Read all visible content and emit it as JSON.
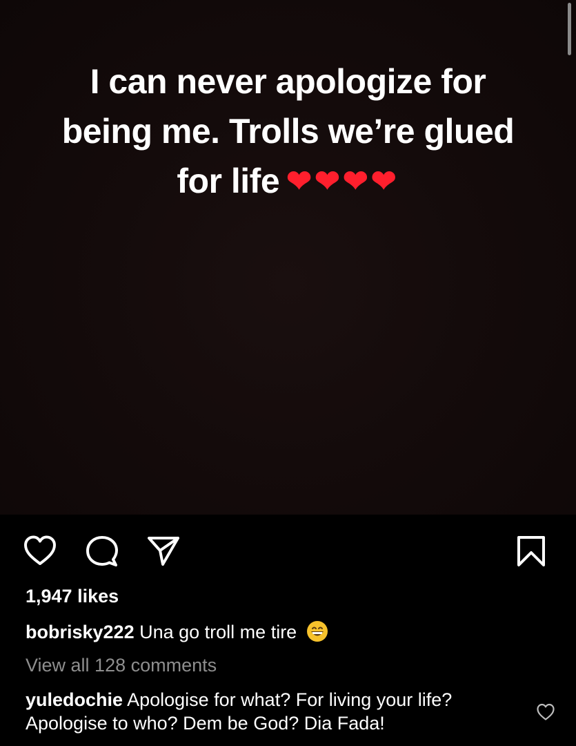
{
  "post": {
    "caption_overlay": "I can never apologize for being me. Trolls we’re glued for life",
    "hearts": "❤❤❤❤"
  },
  "actions": {
    "like_icon": "heart-outline-icon",
    "comment_icon": "comment-bubble-icon",
    "share_icon": "paper-plane-icon",
    "save_icon": "bookmark-icon"
  },
  "likes": "1,947 likes",
  "caption": {
    "username": "bobrisky222",
    "text": "Una go troll me tire",
    "emoji": "grinning-face-emoji"
  },
  "view_comments": "View all 128 comments",
  "top_comment": {
    "username": "yuledochie",
    "text": "Apologise for what? For living your life? Apologise to who? Dem be God? Dia Fada!"
  },
  "colors": {
    "background": "#000000",
    "heart_red": "#ff1f2d",
    "muted_text": "#8e8e8e"
  }
}
